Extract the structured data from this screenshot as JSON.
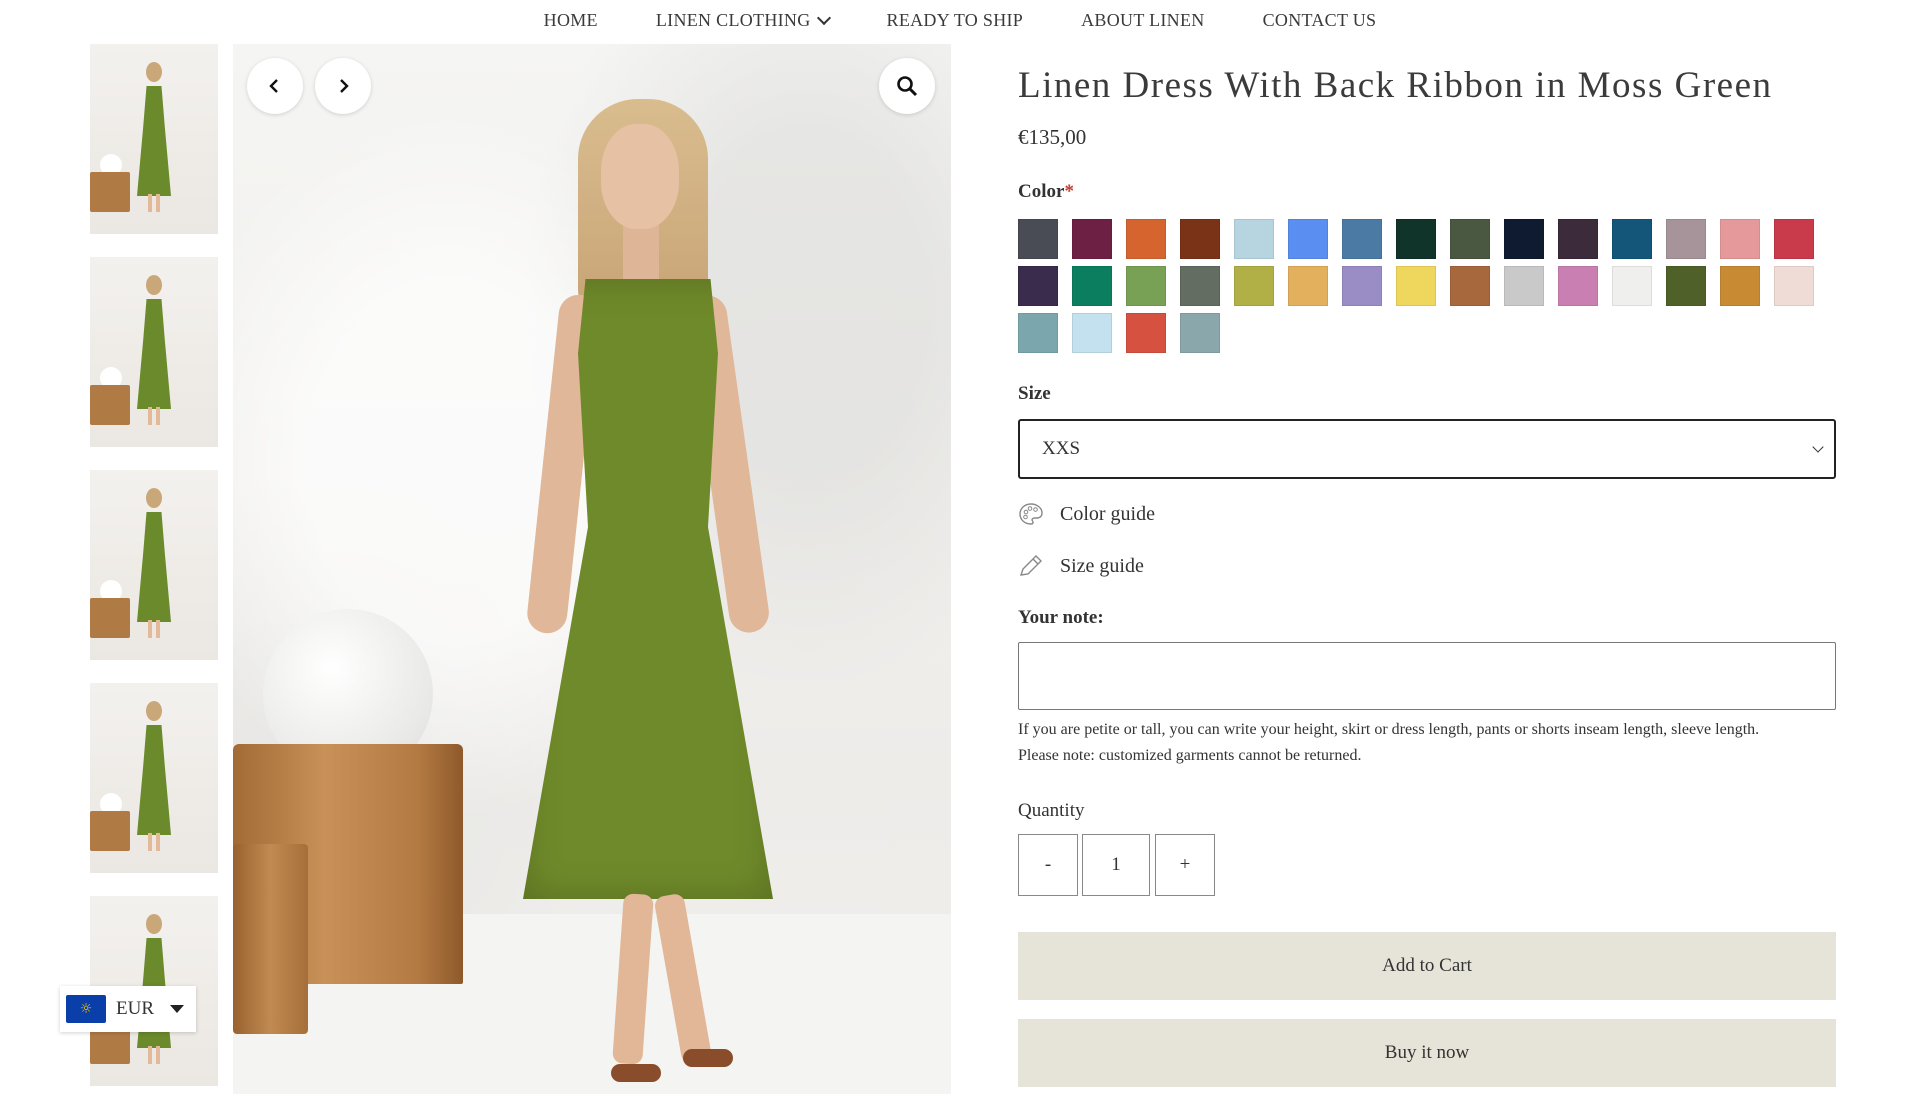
{
  "nav": {
    "items": [
      "HOME",
      "LINEN CLOTHING",
      "READY TO SHIP",
      "ABOUT LINEN",
      "CONTACT US"
    ]
  },
  "gallery": {
    "prev_icon": "chevron-left-icon",
    "next_icon": "chevron-right-icon",
    "zoom_icon": "magnifier-icon"
  },
  "currency": {
    "code": "EUR",
    "flag": "eu-flag-icon"
  },
  "product": {
    "title": "Linen Dress With Back Ribbon in Moss Green",
    "price": "€135,00",
    "color_label": "Color",
    "required_mark": "*",
    "colors": [
      "#4a4c55",
      "#6e1f44",
      "#d6642f",
      "#7a3317",
      "#b7d5e0",
      "#5a8ef0",
      "#4b7aa5",
      "#10342a",
      "#4a5741",
      "#0f1b30",
      "#3c2b3b",
      "#14557a",
      "#a7949b",
      "#e6999a",
      "#c93a4b",
      "#3a2c4c",
      "#0a7e5f",
      "#78a155",
      "#646d62",
      "#b0b046",
      "#e3b05e",
      "#9a8dc6",
      "#efd65d",
      "#a8683d",
      "#c9c9c9",
      "#c97fb1",
      "#efefed",
      "#4f6029",
      "#c88a33",
      "#f0dcd6",
      "#7ba6ae",
      "#c3e1ee",
      "#d65140",
      "#8aa7ab"
    ],
    "size_label": "Size",
    "size_value": "XXS",
    "color_guide": "Color guide",
    "size_guide": "Size guide",
    "note_label": "Your note:",
    "note_value": "",
    "note_help_1": "If you are petite or tall, you can write your height, skirt or dress length, pants or shorts inseam length, sleeve length.",
    "note_help_2": "Please note: customized garments cannot be returned.",
    "quantity_label": "Quantity",
    "qty_minus": "-",
    "qty_value": "1",
    "qty_plus": "+",
    "add_to_cart": "Add to Cart",
    "buy_now": "Buy it now"
  }
}
